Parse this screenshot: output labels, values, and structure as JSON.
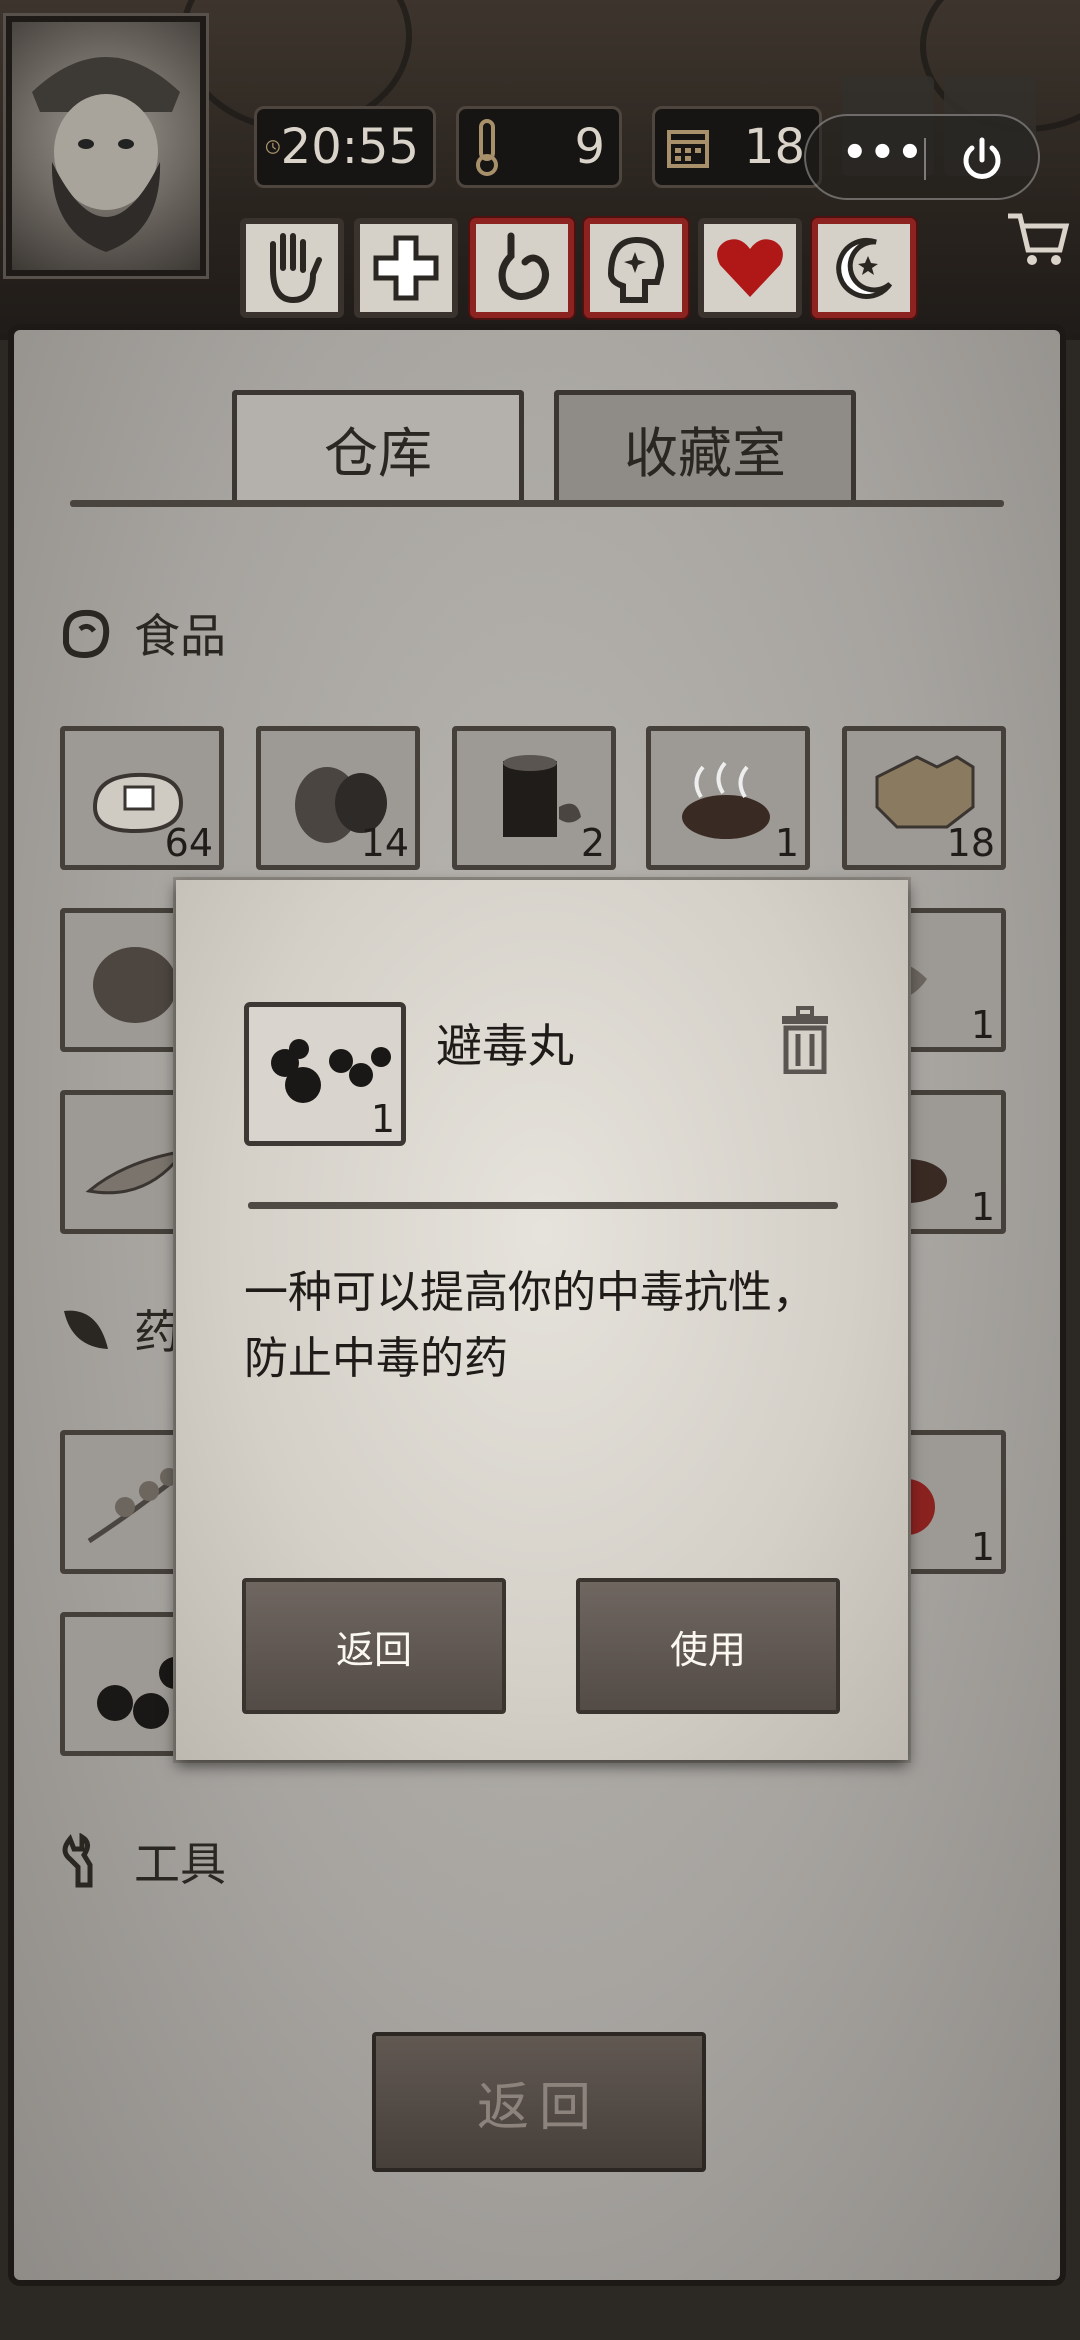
{
  "hud": {
    "time": "20:55",
    "temperature": "9",
    "day": "18",
    "capsule_more": "•••"
  },
  "tabs": [
    {
      "label": "仓库",
      "active": true
    },
    {
      "label": "收藏室",
      "active": false
    }
  ],
  "sections": {
    "food": {
      "title": "食品"
    },
    "medicine": {
      "title": "药"
    },
    "tools": {
      "title": "工具"
    }
  },
  "slots": {
    "row1": [
      "64",
      "14",
      "2",
      "1",
      "18"
    ],
    "row2_right": "1",
    "row3_right": "1",
    "row4_right": "1"
  },
  "modal": {
    "item_name": "避毒丸",
    "item_count": "1",
    "description_line1": "一种可以提高你的中毒抗性，",
    "description_line2": "防止中毒的药",
    "back_label": "返回",
    "use_label": "使用"
  },
  "bottom": {
    "back_label": "返回"
  },
  "colors": {
    "alert_border": "#8d2320",
    "paper": "#a7a4a0",
    "heart": "#b01818"
  }
}
